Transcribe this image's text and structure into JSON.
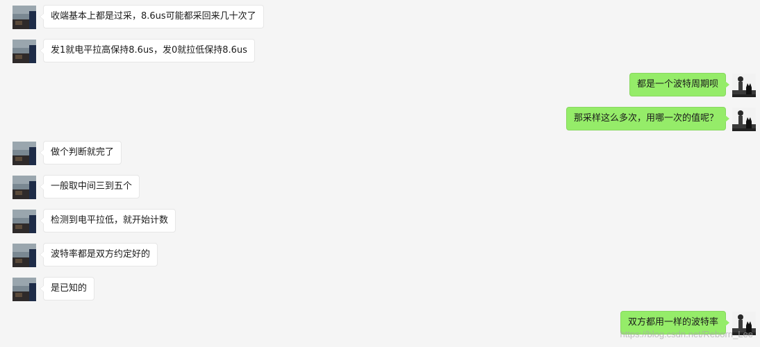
{
  "conversation": {
    "messages": [
      {
        "side": "left",
        "text": "收端基本上都是过采，8.6us可能都采回来几十次了"
      },
      {
        "side": "left",
        "text": "发1就电平拉高保持8.6us，发0就拉低保持8.6us"
      },
      {
        "side": "right",
        "text": "都是一个波特周期呗"
      },
      {
        "side": "right",
        "text": "那采样这么多次，用哪一次的值呢？"
      },
      {
        "side": "left",
        "text": "做个判断就完了"
      },
      {
        "side": "left",
        "text": "一般取中间三到五个"
      },
      {
        "side": "left",
        "text": "检测到电平拉低，就开始计数"
      },
      {
        "side": "left",
        "text": "波特率都是双方约定好的"
      },
      {
        "side": "left",
        "text": "是已知的"
      },
      {
        "side": "right",
        "text": "双方都用一样的波特率"
      }
    ]
  },
  "watermark": "https://blog.csdn.net/Reborn_Lee",
  "colors": {
    "background": "#f5f5f5",
    "incoming_bubble": "#ffffff",
    "outgoing_bubble": "#95ec69"
  },
  "icons": {
    "left_avatar": "landscape-avatar-icon",
    "right_avatar": "person-with-cat-avatar-icon"
  }
}
